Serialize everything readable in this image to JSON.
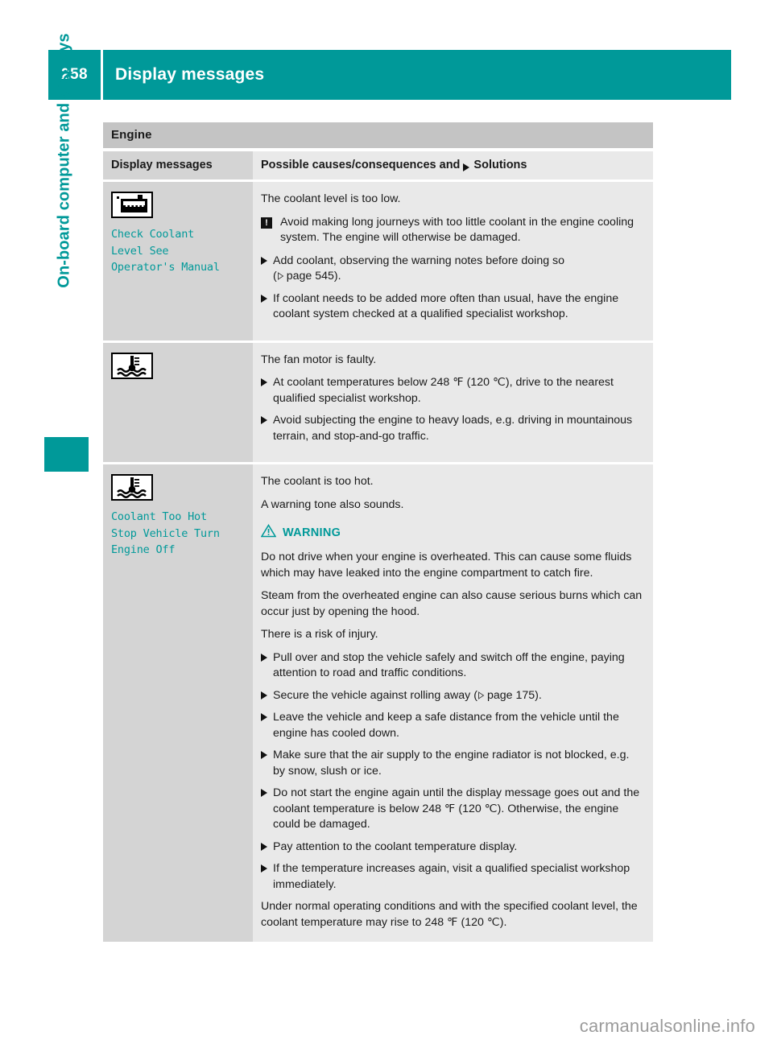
{
  "header": {
    "page_number": "258",
    "title": "Display messages",
    "accent_color": "#009999"
  },
  "chapter": {
    "vertical_title": "On-board computer and displays"
  },
  "table": {
    "section_band": "Engine",
    "columns": {
      "left": "Display messages",
      "right_prefix": "Possible causes/consequences and",
      "right_suffix": "Solutions"
    },
    "rows": [
      {
        "icon_name": "coolant-level-icon",
        "display_message_lines": [
          "Check Coolant",
          "Level See",
          "Operator's Manual"
        ],
        "blocks": [
          {
            "kind": "para",
            "text": "The coolant level is too low."
          },
          {
            "kind": "note",
            "marker": "!",
            "text": "Avoid making long journeys with too little coolant in the engine cooling system. The engine will otherwise be damaged."
          },
          {
            "kind": "bullet",
            "text": "Add coolant, observing the warning notes before doing so",
            "ref": "page 545"
          },
          {
            "kind": "bullet",
            "text": "If coolant needs to be added more often than usual, have the engine coolant system checked at a qualified specialist workshop."
          }
        ]
      },
      {
        "icon_name": "coolant-temperature-icon",
        "display_message_lines": [],
        "blocks": [
          {
            "kind": "para",
            "text": "The fan motor is faulty."
          },
          {
            "kind": "bullet",
            "text": "At coolant temperatures below 248 ℉ (120 ℃), drive to the nearest qualified specialist workshop."
          },
          {
            "kind": "bullet",
            "text": "Avoid subjecting the engine to heavy loads, e.g. driving in mountainous terrain, and stop-and-go traffic."
          }
        ]
      },
      {
        "icon_name": "coolant-temperature-icon",
        "display_message_lines": [
          "Coolant Too Hot",
          "Stop Vehicle Turn",
          "Engine Off"
        ],
        "blocks": [
          {
            "kind": "para",
            "text": "The coolant is too hot."
          },
          {
            "kind": "para",
            "text": "A warning tone also sounds."
          },
          {
            "kind": "warning-head",
            "label": "WARNING"
          },
          {
            "kind": "para",
            "text": "Do not drive when your engine is overheated. This can cause some fluids which may have leaked into the engine compartment to catch fire."
          },
          {
            "kind": "para",
            "text": "Steam from the overheated engine can also cause serious burns which can occur just by opening the hood."
          },
          {
            "kind": "para",
            "text": "There is a risk of injury."
          },
          {
            "kind": "bullet",
            "text": "Pull over and stop the vehicle safely and switch off the engine, paying attention to road and traffic conditions."
          },
          {
            "kind": "bullet",
            "text": "Secure the vehicle against rolling away",
            "ref": "page 175",
            "ref_inline": true
          },
          {
            "kind": "bullet",
            "text": "Leave the vehicle and keep a safe distance from the vehicle until the engine has cooled down."
          },
          {
            "kind": "bullet",
            "text": "Make sure that the air supply to the engine radiator is not blocked, e.g. by snow, slush or ice."
          },
          {
            "kind": "bullet",
            "text": "Do not start the engine again until the display message goes out and the coolant temperature is below 248 ℉ (120 ℃). Otherwise, the engine could be damaged."
          },
          {
            "kind": "bullet",
            "text": "Pay attention to the coolant temperature display."
          },
          {
            "kind": "bullet",
            "text": "If the temperature increases again, visit a qualified specialist workshop immediately."
          },
          {
            "kind": "para",
            "text": "Under normal operating conditions and with the specified coolant level, the coolant temperature may rise to 248 ℉ (120 ℃)."
          }
        ]
      }
    ]
  },
  "watermark": "carmanualsonline.info"
}
